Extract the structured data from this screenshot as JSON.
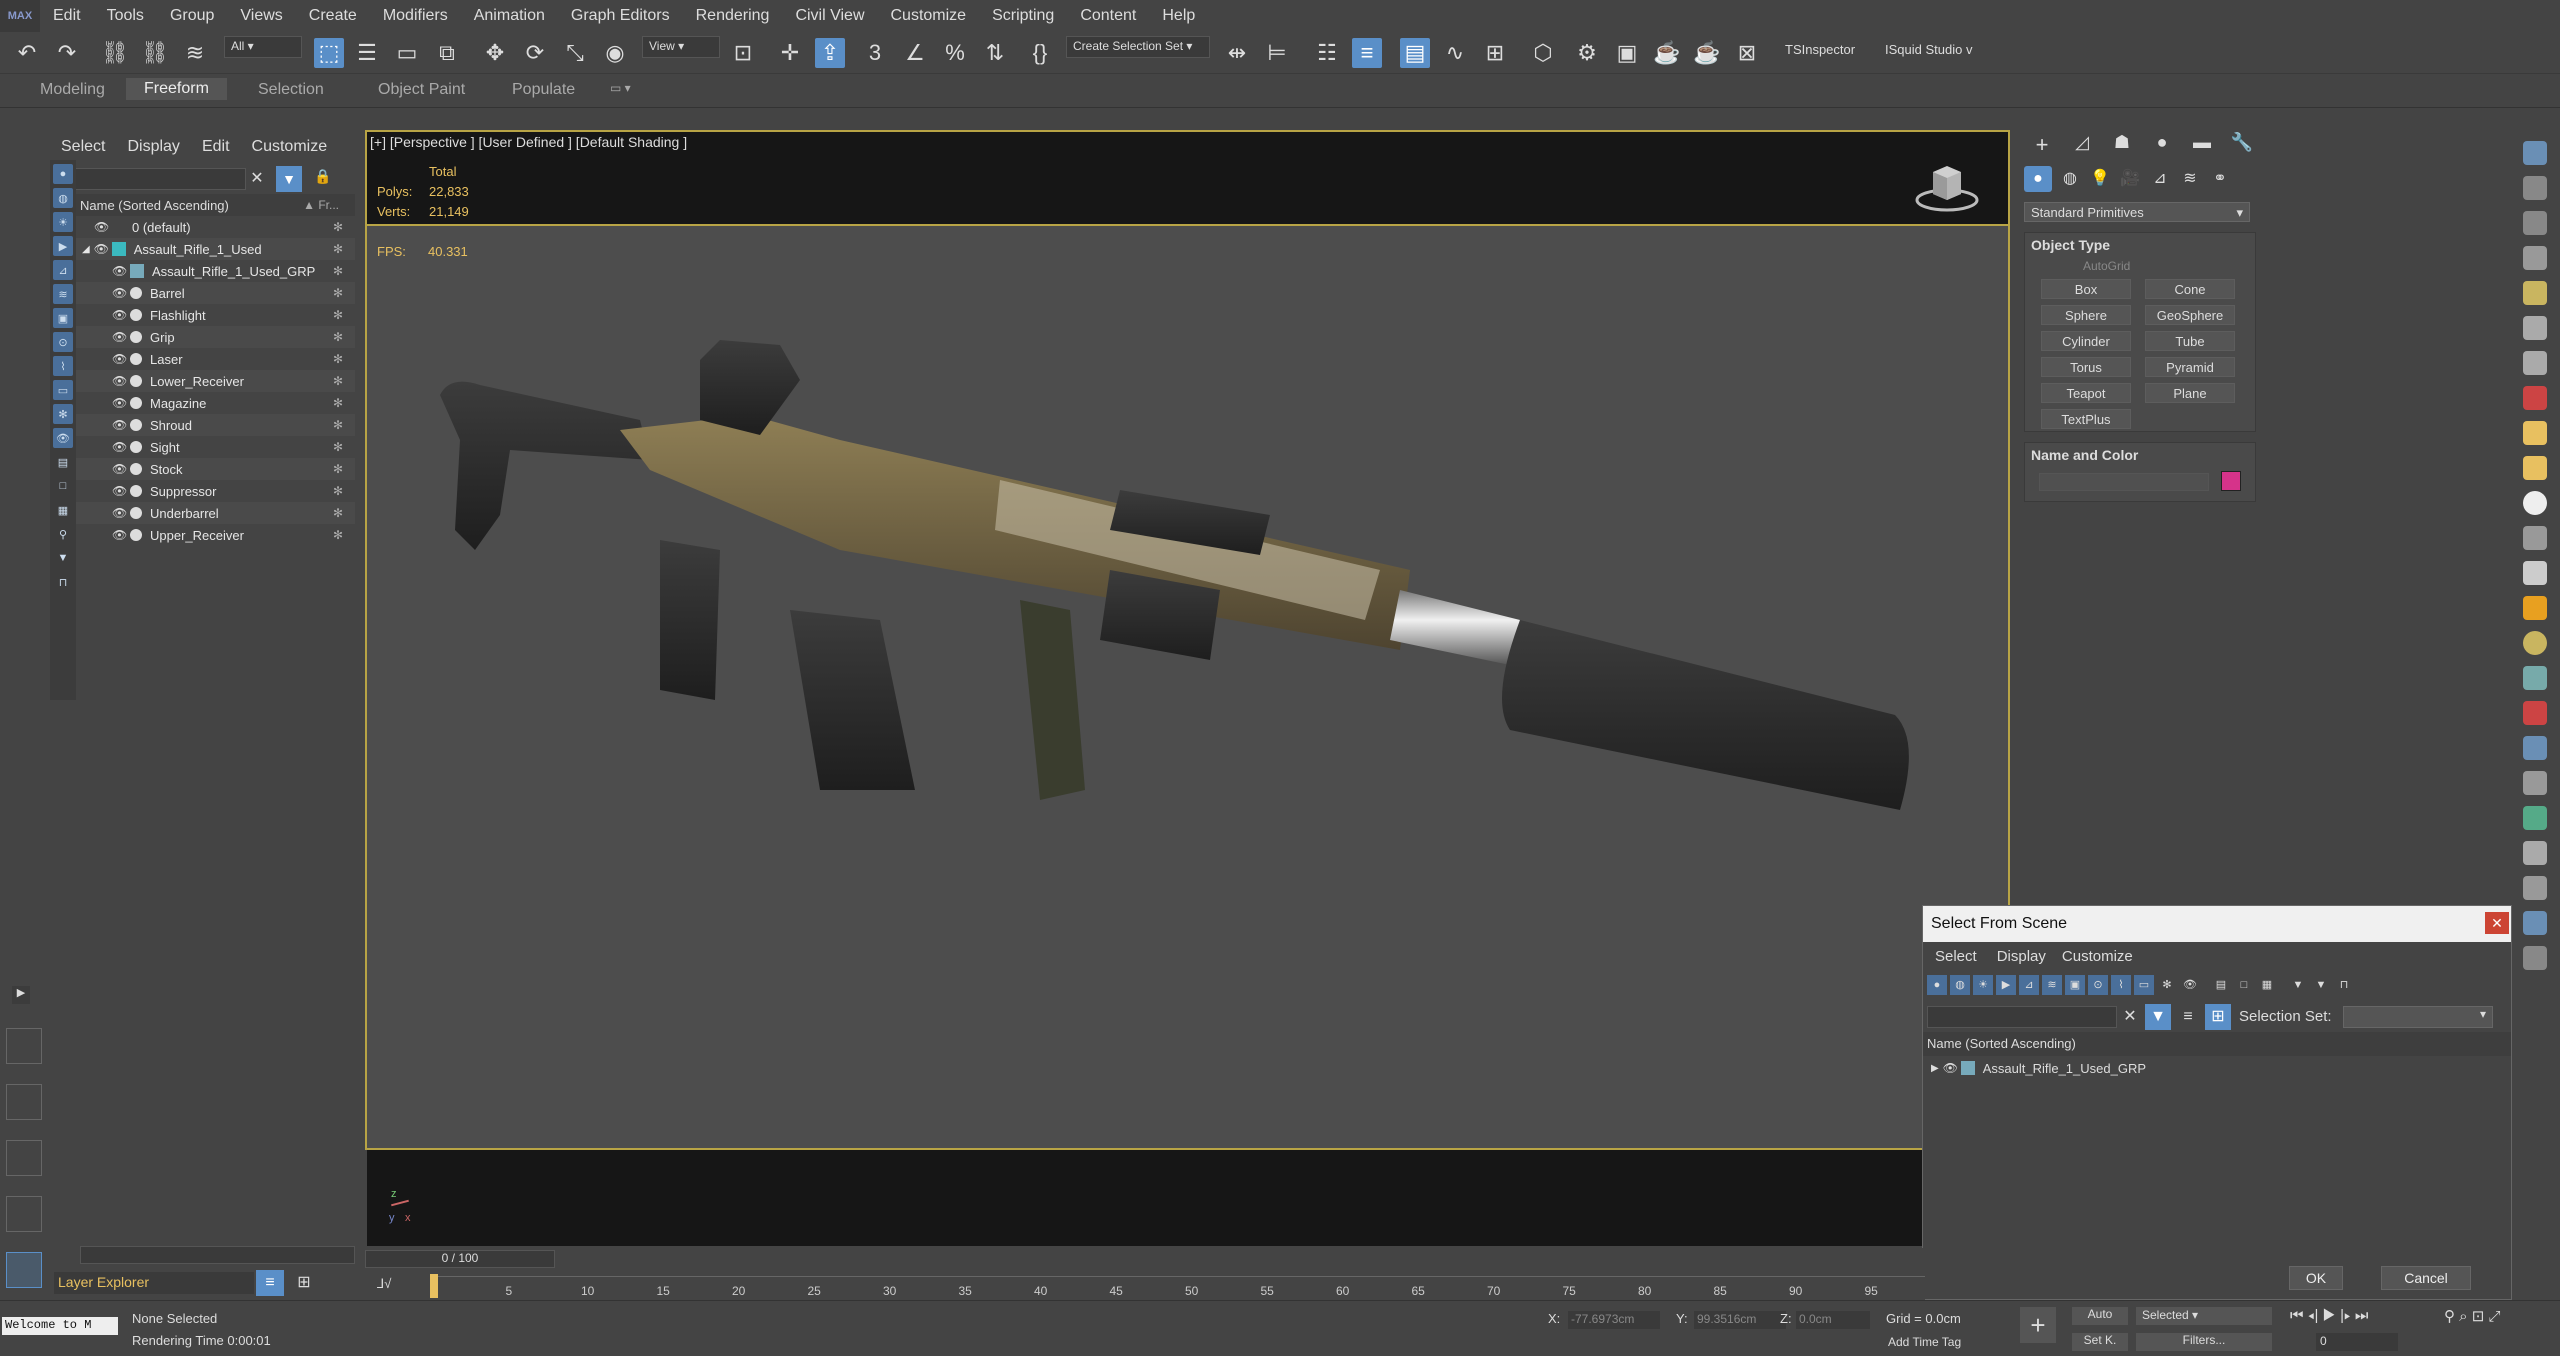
{
  "menu": {
    "logo": "MAX",
    "items": [
      "Edit",
      "Tools",
      "Group",
      "Views",
      "Create",
      "Modifiers",
      "Animation",
      "Graph Editors",
      "Rendering",
      "Civil View",
      "Customize",
      "Scripting",
      "Content",
      "Help"
    ]
  },
  "toolbar": {
    "filter_value": "All",
    "refcoord_value": "View",
    "selection_set_value": "Create Selection Set",
    "ts_inspector": "TSInspector",
    "isquid_studio": "ISquid Studio v"
  },
  "ribbon": {
    "tabs": [
      "Modeling",
      "Freeform",
      "Selection",
      "Object Paint",
      "Populate"
    ],
    "active": "Freeform"
  },
  "explorer": {
    "menu": [
      "Select",
      "Display",
      "Edit",
      "Customize"
    ],
    "column_name": "Name (Sorted Ascending)",
    "column_frozen": "▲ Fr...",
    "rows": [
      {
        "name": "0 (default)"
      },
      {
        "name": "Assault_Rifle_1_Used"
      },
      {
        "name": "Assault_Rifle_1_Used_GRP"
      },
      {
        "name": "Barrel"
      },
      {
        "name": "Flashlight"
      },
      {
        "name": "Grip"
      },
      {
        "name": "Laser"
      },
      {
        "name": "Lower_Receiver"
      },
      {
        "name": "Magazine"
      },
      {
        "name": "Shroud"
      },
      {
        "name": "Sight"
      },
      {
        "name": "Stock"
      },
      {
        "name": "Suppressor"
      },
      {
        "name": "Underbarrel"
      },
      {
        "name": "Upper_Receiver"
      }
    ],
    "footer_label": "Layer Explorer"
  },
  "viewport": {
    "label": "[+] [Perspective ] [User Defined ] [Default Shading ]",
    "stats_total": "Total",
    "polys_label": "Polys:",
    "polys_value": "22,833",
    "verts_label": "Verts:",
    "verts_value": "21,149",
    "fps_label": "FPS:",
    "fps_value": "40.331",
    "axis_x": "x",
    "axis_y": "y",
    "axis_z": "z"
  },
  "select_from_scene": {
    "title": "Select From Scene",
    "close": "✕",
    "menu": [
      "Select",
      "Display",
      "Customize"
    ],
    "selection_set_label": "Selection Set:",
    "column_name": "Name (Sorted Ascending)",
    "row": "Assault_Rifle_1_Used_GRP",
    "ok": "OK",
    "cancel": "Cancel"
  },
  "command_panel": {
    "dropdown": "Standard Primitives",
    "object_type_label": "Object Type",
    "autogrid": "AutoGrid",
    "primitives": [
      "Box",
      "Cone",
      "Sphere",
      "GeoSphere",
      "Cylinder",
      "Tube",
      "Torus",
      "Pyramid",
      "Teapot",
      "Plane",
      "TextPlus"
    ],
    "name_color_label": "Name and Color",
    "color": "#d6338a"
  },
  "timeline": {
    "frame_label": "0 / 100",
    "ticks": [
      "5",
      "10",
      "15",
      "20",
      "25",
      "30",
      "35",
      "40",
      "45",
      "50",
      "55",
      "60",
      "65",
      "70",
      "75",
      "80",
      "85",
      "90",
      "95"
    ]
  },
  "status": {
    "maxscript": "Welcome to M",
    "selected": "None Selected",
    "render_time": "Rendering Time  0:00:01",
    "x_label": "X:",
    "x_value": "-77.6973cm",
    "y_label": "Y:",
    "y_value": "99.3516cm",
    "z_label": "Z:",
    "z_value": "0.0cm",
    "grid": "Grid = 0.0cm",
    "add_time_tag": "Add Time Tag",
    "auto": "Auto",
    "set_key": "Set K.",
    "selected_dd": "Selected",
    "filters": "Filters...",
    "frame_value": "0"
  }
}
